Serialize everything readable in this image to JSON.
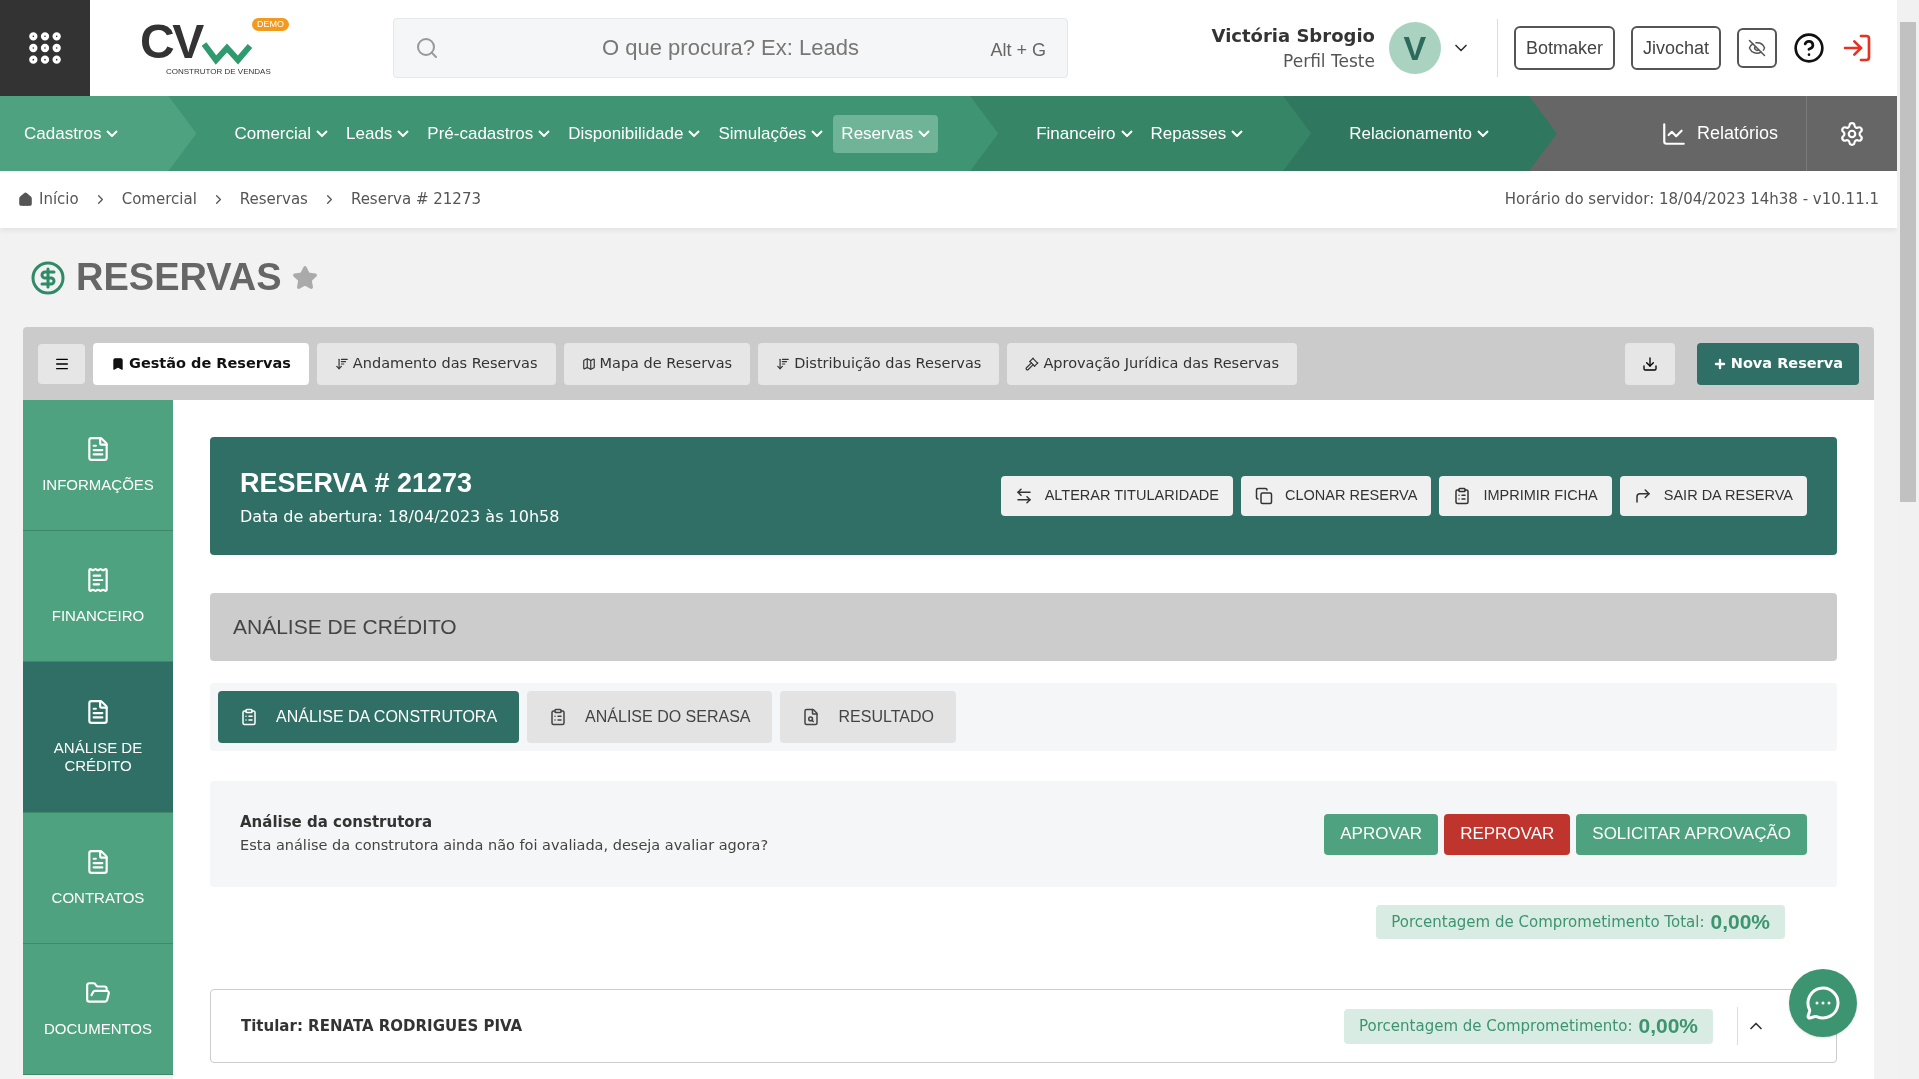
{
  "header": {
    "logo": {
      "mark": "CV",
      "badge": "DEMO",
      "tagline": "CONSTRUTOR DE VENDAS"
    },
    "search": {
      "placeholder": "O que procura? Ex: Leads",
      "shortcut": "Alt + G"
    },
    "user": {
      "name": "Victória Sbrogio",
      "profile": "Perfil Teste",
      "initial": "V"
    },
    "buttons": [
      "Botmaker",
      "Jivochat"
    ]
  },
  "nav": {
    "segments": [
      {
        "items": [
          {
            "label": "Cadastros",
            "selected": false
          }
        ]
      },
      {
        "items": [
          {
            "label": "Comercial",
            "selected": false
          },
          {
            "label": "Leads",
            "selected": false
          },
          {
            "label": "Pré-cadastros",
            "selected": false
          },
          {
            "label": "Disponibilidade",
            "selected": false
          },
          {
            "label": "Simulações",
            "selected": false
          },
          {
            "label": "Reservas",
            "selected": true
          }
        ]
      },
      {
        "items": [
          {
            "label": "Financeiro",
            "selected": false
          },
          {
            "label": "Repasses",
            "selected": false
          }
        ]
      },
      {
        "items": [
          {
            "label": "Relacionamento",
            "selected": false
          }
        ]
      }
    ],
    "reports": "Relatórios"
  },
  "breadcrumb": [
    "Início",
    "Comercial",
    "Reservas",
    "Reserva # 21273"
  ],
  "server_time": "Horário do servidor: 18/04/2023 14h38 - v10.11.1",
  "page_title": "RESERVAS",
  "toolbar": {
    "tabs": [
      {
        "label": "Gestão de Reservas",
        "selected": true
      },
      {
        "label": "Andamento das Reservas",
        "selected": false
      },
      {
        "label": "Mapa de Reservas",
        "selected": false
      },
      {
        "label": "Distribuição das Reservas",
        "selected": false
      },
      {
        "label": "Aprovação Jurídica das Reservas",
        "selected": false
      }
    ],
    "new_button": "Nova Reserva"
  },
  "sidebar": [
    {
      "label": "INFORMAÇÕES",
      "selected": false
    },
    {
      "label": "FINANCEIRO",
      "selected": false
    },
    {
      "label": "ANÁLISE DE CRÉDITO",
      "selected": true
    },
    {
      "label": "CONTRATOS",
      "selected": false
    },
    {
      "label": "DOCUMENTOS",
      "selected": false
    }
  ],
  "reservation": {
    "title": "RESERVA # 21273",
    "opened": "Data de abertura: 18/04/2023 às 10h58",
    "actions": [
      "ALTERAR TITULARIDADE",
      "CLONAR RESERVA",
      "IMPRIMIR FICHA",
      "SAIR DA RESERVA"
    ]
  },
  "section_title": "ANÁLISE DE CRÉDITO",
  "subtabs": [
    {
      "label": "ANÁLISE DA CONSTRUTORA",
      "selected": true
    },
    {
      "label": "ANÁLISE DO SERASA",
      "selected": false
    },
    {
      "label": "RESULTADO",
      "selected": false
    }
  ],
  "analysis": {
    "title": "Análise da construtora",
    "text": "Esta análise da construtora ainda não foi avaliada, deseja avaliar agora?",
    "buttons": [
      {
        "label": "APROVAR",
        "kind": "approve"
      },
      {
        "label": "REPROVAR",
        "kind": "reject"
      },
      {
        "label": "SOLICITAR APROVAÇÃO",
        "kind": "request"
      }
    ]
  },
  "total_commitment": {
    "label": "Porcentagem de Comprometimento Total:",
    "value": "0,00%"
  },
  "holder": {
    "title": "Titular: RENATA RODRIGUES PIVA",
    "commitment_label": "Porcentagem de Comprometimento:",
    "commitment_value": "0,00%"
  }
}
